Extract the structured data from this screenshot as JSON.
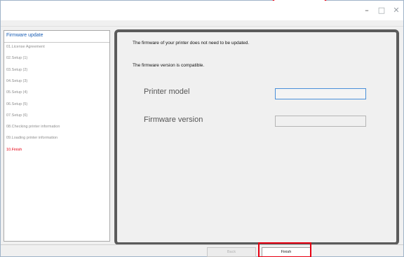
{
  "window": {
    "controls": {
      "minimize": "–",
      "maximize": "□",
      "close": "✕"
    }
  },
  "sidebar": {
    "title": "Firmware update",
    "steps": [
      {
        "label": "01.License Agreement",
        "active": false
      },
      {
        "label": "02.Setup (1)",
        "active": false
      },
      {
        "label": "03.Setup (2)",
        "active": false
      },
      {
        "label": "04.Setup (3)",
        "active": false
      },
      {
        "label": "05.Setup (4)",
        "active": false
      },
      {
        "label": "06.Setup (5)",
        "active": false
      },
      {
        "label": "07.Setup (6)",
        "active": false
      },
      {
        "label": "08.Checking printer information",
        "active": false
      },
      {
        "label": "09.Loading printer information",
        "active": false
      },
      {
        "label": "10.Finish",
        "active": true
      }
    ]
  },
  "main": {
    "message_1": "The firmware of your printer does not need to be updated.",
    "message_2": "The firmware version is compatible.",
    "printer_model_label": "Printer model",
    "printer_model_value": "",
    "firmware_version_label": "Firmware version",
    "firmware_version_value": ""
  },
  "footer": {
    "back_label": "Back",
    "finish_label": "Finish"
  },
  "colors": {
    "accent_red": "#e60012",
    "link_blue": "#1b5fb5"
  }
}
